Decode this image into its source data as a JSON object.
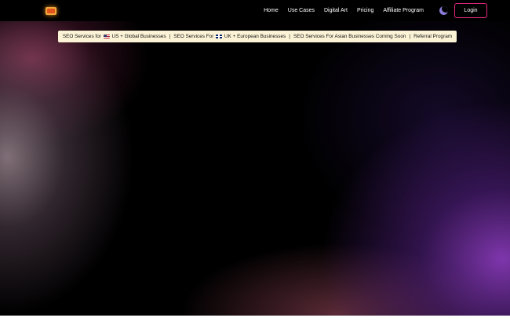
{
  "header": {
    "logo": "logo-icon",
    "nav": [
      {
        "label": "Home"
      },
      {
        "label": "Use Cases"
      },
      {
        "label": "Digital Art"
      },
      {
        "label": "Pricing"
      },
      {
        "label": "Affiliate Program"
      }
    ],
    "theme_toggle": "moon-icon",
    "login_label": "Login"
  },
  "banner": {
    "item1_prefix": "SEO Services for",
    "item1_suffix": "US + Global Businesses",
    "item2_prefix": "SEO Services For",
    "item2_suffix": "UK + European Businesses",
    "item3": "SEO Services For Asian Businesses Coming Soon",
    "item4": "Referral Program",
    "separator": "|"
  },
  "colors": {
    "login_border": "#e0287f",
    "banner_bg": "#fcf3d6",
    "logo": "#f2a93b"
  }
}
